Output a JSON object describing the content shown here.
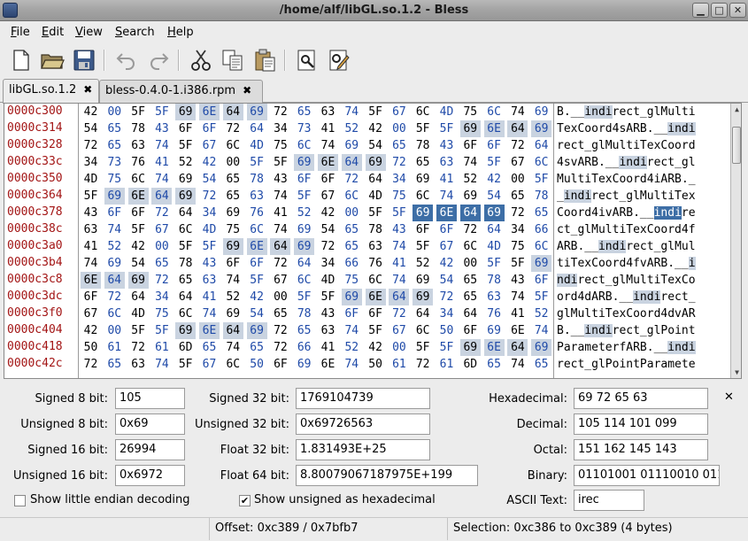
{
  "window": {
    "title": "/home/alf/libGL.so.1.2 - Bless"
  },
  "menu": [
    {
      "pre": "",
      "u": "F",
      "post": "ile"
    },
    {
      "pre": "",
      "u": "E",
      "post": "dit"
    },
    {
      "pre": "",
      "u": "V",
      "post": "iew"
    },
    {
      "pre": "",
      "u": "S",
      "post": "earch"
    },
    {
      "pre": "",
      "u": "H",
      "post": "elp"
    }
  ],
  "toolbar": {
    "icons": [
      "new-file-icon",
      "open-folder-icon",
      "save-icon",
      "undo-icon",
      "redo-icon",
      "cut-icon",
      "copy-icon",
      "paste-icon",
      "find-icon",
      "replace-icon"
    ]
  },
  "tabs": [
    {
      "label": "libGL.so.1.2",
      "close": "✖",
      "active": true
    },
    {
      "label": "bless-0.4.0-1.i386.rpm",
      "close": "✖",
      "active": false
    }
  ],
  "hex": {
    "rows": [
      {
        "offset": "0000c300",
        "bytes": [
          "42",
          "00",
          "5F",
          "5F",
          "69",
          "6E",
          "64",
          "69",
          "72",
          "65",
          "63",
          "74",
          "5F",
          "67",
          "6C",
          "4D",
          "75",
          "6C",
          "74",
          "69"
        ],
        "ascii": "B.__indirect_glMulti"
      },
      {
        "offset": "0000c314",
        "bytes": [
          "54",
          "65",
          "78",
          "43",
          "6F",
          "6F",
          "72",
          "64",
          "34",
          "73",
          "41",
          "52",
          "42",
          "00",
          "5F",
          "5F",
          "69",
          "6E",
          "64",
          "69"
        ],
        "ascii": "TexCoord4sARB.__indi"
      },
      {
        "offset": "0000c328",
        "bytes": [
          "72",
          "65",
          "63",
          "74",
          "5F",
          "67",
          "6C",
          "4D",
          "75",
          "6C",
          "74",
          "69",
          "54",
          "65",
          "78",
          "43",
          "6F",
          "6F",
          "72",
          "64"
        ],
        "ascii": "rect_glMultiTexCoord"
      },
      {
        "offset": "0000c33c",
        "bytes": [
          "34",
          "73",
          "76",
          "41",
          "52",
          "42",
          "00",
          "5F",
          "5F",
          "69",
          "6E",
          "64",
          "69",
          "72",
          "65",
          "63",
          "74",
          "5F",
          "67",
          "6C"
        ],
        "ascii": "4svARB.__indirect_gl"
      },
      {
        "offset": "0000c350",
        "bytes": [
          "4D",
          "75",
          "6C",
          "74",
          "69",
          "54",
          "65",
          "78",
          "43",
          "6F",
          "6F",
          "72",
          "64",
          "34",
          "69",
          "41",
          "52",
          "42",
          "00",
          "5F"
        ],
        "ascii": "MultiTexCoord4iARB._"
      },
      {
        "offset": "0000c364",
        "bytes": [
          "5F",
          "69",
          "6E",
          "64",
          "69",
          "72",
          "65",
          "63",
          "74",
          "5F",
          "67",
          "6C",
          "4D",
          "75",
          "6C",
          "74",
          "69",
          "54",
          "65",
          "78"
        ],
        "ascii": "_indirect_glMultiTex"
      },
      {
        "offset": "0000c378",
        "bytes": [
          "43",
          "6F",
          "6F",
          "72",
          "64",
          "34",
          "69",
          "76",
          "41",
          "52",
          "42",
          "00",
          "5F",
          "5F",
          "69",
          "6E",
          "64",
          "69",
          "72",
          "65"
        ],
        "ascii": "Coord4ivARB.__indire"
      },
      {
        "offset": "0000c38c",
        "bytes": [
          "63",
          "74",
          "5F",
          "67",
          "6C",
          "4D",
          "75",
          "6C",
          "74",
          "69",
          "54",
          "65",
          "78",
          "43",
          "6F",
          "6F",
          "72",
          "64",
          "34",
          "66"
        ],
        "ascii": "ct_glMultiTexCoord4f"
      },
      {
        "offset": "0000c3a0",
        "bytes": [
          "41",
          "52",
          "42",
          "00",
          "5F",
          "5F",
          "69",
          "6E",
          "64",
          "69",
          "72",
          "65",
          "63",
          "74",
          "5F",
          "67",
          "6C",
          "4D",
          "75",
          "6C"
        ],
        "ascii": "ARB.__indirect_glMul"
      },
      {
        "offset": "0000c3b4",
        "bytes": [
          "74",
          "69",
          "54",
          "65",
          "78",
          "43",
          "6F",
          "6F",
          "72",
          "64",
          "34",
          "66",
          "76",
          "41",
          "52",
          "42",
          "00",
          "5F",
          "5F",
          "69"
        ],
        "ascii": "tiTexCoord4fvARB.__i"
      },
      {
        "offset": "0000c3c8",
        "bytes": [
          "6E",
          "64",
          "69",
          "72",
          "65",
          "63",
          "74",
          "5F",
          "67",
          "6C",
          "4D",
          "75",
          "6C",
          "74",
          "69",
          "54",
          "65",
          "78",
          "43",
          "6F"
        ],
        "ascii": "ndirect_glMultiTexCo"
      },
      {
        "offset": "0000c3dc",
        "bytes": [
          "6F",
          "72",
          "64",
          "34",
          "64",
          "41",
          "52",
          "42",
          "00",
          "5F",
          "5F",
          "69",
          "6E",
          "64",
          "69",
          "72",
          "65",
          "63",
          "74",
          "5F"
        ],
        "ascii": "ord4dARB.__indirect_"
      },
      {
        "offset": "0000c3f0",
        "bytes": [
          "67",
          "6C",
          "4D",
          "75",
          "6C",
          "74",
          "69",
          "54",
          "65",
          "78",
          "43",
          "6F",
          "6F",
          "72",
          "64",
          "34",
          "64",
          "76",
          "41",
          "52"
        ],
        "ascii": "glMultiTexCoord4dvAR"
      },
      {
        "offset": "0000c404",
        "bytes": [
          "42",
          "00",
          "5F",
          "5F",
          "69",
          "6E",
          "64",
          "69",
          "72",
          "65",
          "63",
          "74",
          "5F",
          "67",
          "6C",
          "50",
          "6F",
          "69",
          "6E",
          "74"
        ],
        "ascii": "B.__indirect_glPoint"
      },
      {
        "offset": "0000c418",
        "bytes": [
          "50",
          "61",
          "72",
          "61",
          "6D",
          "65",
          "74",
          "65",
          "72",
          "66",
          "41",
          "52",
          "42",
          "00",
          "5F",
          "5F",
          "69",
          "6E",
          "64",
          "69"
        ],
        "ascii": "ParameterfARB.__indi"
      },
      {
        "offset": "0000c42c",
        "bytes": [
          "72",
          "65",
          "63",
          "74",
          "5F",
          "67",
          "6C",
          "50",
          "6F",
          "69",
          "6E",
          "74",
          "50",
          "61",
          "72",
          "61",
          "6D",
          "65",
          "74",
          "65"
        ],
        "ascii": "rect_glPointParamete"
      }
    ]
  },
  "converter": {
    "signed8": {
      "label": "Signed 8 bit:",
      "value": "105"
    },
    "unsigned8": {
      "label": "Unsigned 8 bit:",
      "value": "0x69"
    },
    "signed16": {
      "label": "Signed 16 bit:",
      "value": "26994"
    },
    "unsigned16": {
      "label": "Unsigned 16 bit:",
      "value": "0x6972"
    },
    "signed32": {
      "label": "Signed 32 bit:",
      "value": "1769104739"
    },
    "unsigned32": {
      "label": "Unsigned 32 bit:",
      "value": "0x69726563"
    },
    "float32": {
      "label": "Float 32 bit:",
      "value": "1.831493E+25"
    },
    "float64": {
      "label": "Float 64 bit:",
      "value": "8.80079067187975E+199"
    },
    "hexadecimal": {
      "label": "Hexadecimal:",
      "value": "69 72 65 63"
    },
    "decimal": {
      "label": "Decimal:",
      "value": "105 114 101 099"
    },
    "octal": {
      "label": "Octal:",
      "value": "151 162 145 143"
    },
    "binary": {
      "label": "Binary:",
      "value": "01101001 01110010 011"
    },
    "ascii": {
      "label": "ASCII Text:",
      "value": "irec"
    },
    "close": "✕",
    "little_endian": {
      "label": "Show little endian decoding",
      "checked": false
    },
    "unsigned_hex": {
      "label": "Show unsigned as hexadecimal",
      "checked": true,
      "mark": "✔"
    }
  },
  "status": {
    "offset": "Offset: 0xc389 / 0x7bfb7",
    "selection": "Selection: 0xc386 to 0xc389 (4 bytes)"
  },
  "colors": {
    "highlight": "#c9d3e0",
    "selection": "#3d6ea6",
    "offset_text": "#a31515",
    "odd_byte_text": "#1f4aa8"
  }
}
